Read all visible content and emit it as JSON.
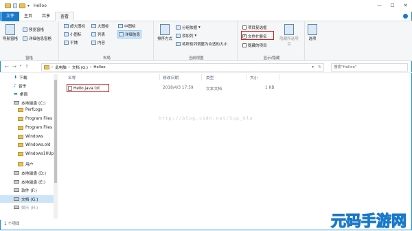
{
  "window": {
    "title": "Helloo",
    "minimize": "—",
    "maximize": "☐",
    "close": "✕"
  },
  "tabs": [
    {
      "label": "文件"
    },
    {
      "label": "主页"
    },
    {
      "label": "共享"
    },
    {
      "label": "查看"
    }
  ],
  "ribbon": {
    "pane": {
      "nav_pane": "导航窗格",
      "preview": "预览窗格",
      "details": "详细信息窗格",
      "label": "窗格"
    },
    "layout": {
      "xl": "超大图标",
      "large": "大图标",
      "medium": "中图标",
      "small": "小图标",
      "list": "列表",
      "details": "详细信息",
      "tiles": "平铺",
      "content": "内容",
      "label": "布局"
    },
    "view": {
      "sort": "排序方式",
      "group": "分组依据",
      "add_col": "添加列",
      "fit_cols": "将所有列调整为合适的大小",
      "label": "当前视图"
    },
    "show": {
      "checkboxes": "项目复选框",
      "extensions": "文件扩展名",
      "hidden": "隐藏的项目",
      "hide_selected": "隐藏所选项目",
      "options": "选项",
      "label": "显示/隐藏"
    }
  },
  "address": {
    "path": [
      "此电脑",
      "文档 (G:)",
      "Helloo"
    ],
    "search_placeholder": "搜索\"Helloo\""
  },
  "nav": {
    "back": "←",
    "forward": "→",
    "up": "↑"
  },
  "sidebar": [
    {
      "label": "下载",
      "type": "star"
    },
    {
      "label": "音乐",
      "type": "star"
    },
    {
      "label": "桌面",
      "type": "star"
    },
    {
      "label": "本地磁盘 (C:)",
      "type": "drive"
    },
    {
      "label": "PerfLogs",
      "type": "folder"
    },
    {
      "label": "Program Files",
      "type": "folder"
    },
    {
      "label": "Program Files",
      "type": "folder"
    },
    {
      "label": "Windows",
      "type": "folder"
    },
    {
      "label": "Windows.old",
      "type": "folder"
    },
    {
      "label": "Windows10Up",
      "type": "folder"
    },
    {
      "label": "用户",
      "type": "folder"
    },
    {
      "label": "本地磁盘 (D:)",
      "type": "drive"
    },
    {
      "label": "本地磁盘 (E:)",
      "type": "drive"
    },
    {
      "label": "软件 (F:)",
      "type": "drive"
    },
    {
      "label": "文档 (G:)",
      "type": "drive"
    },
    {
      "label": "娱乐 (H:)",
      "type": "drive"
    }
  ],
  "columns": {
    "name": "名称",
    "date": "修改日期",
    "type": "类型",
    "size": "大小"
  },
  "files": [
    {
      "name": "Hello.java.txt",
      "date": "2018/4/3 17:59",
      "type": "文本文档",
      "size": "1 KB"
    }
  ],
  "watermark": "http://blog.csdn.net/Sup_klu",
  "status": "1 个项目",
  "logo": "元码手游网"
}
